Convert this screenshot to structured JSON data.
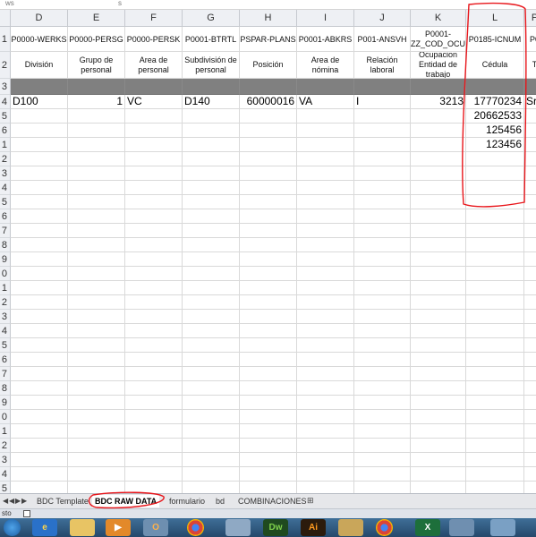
{
  "columns": [
    "D",
    "E",
    "F",
    "G",
    "H",
    "I",
    "J",
    "K",
    "L",
    "P"
  ],
  "rows": [
    "1",
    "2",
    "3",
    "4",
    "5",
    "6",
    "1",
    "2",
    "3",
    "4",
    "5",
    "6",
    "7",
    "8",
    "9",
    "0",
    "1",
    "2",
    "3",
    "4",
    "5",
    "6",
    "7",
    "8",
    "9",
    "0",
    "1",
    "2",
    "3",
    "4",
    "5"
  ],
  "row1_codes": [
    "P0000-WERKS",
    "P0000-PERSG",
    "P0000-PERSK",
    "P0001-BTRTL",
    "PSPAR-PLANS",
    "P0001-ABKRS",
    "P001-ANSVH",
    "P0001-\nZZ_COD_OCU",
    "P0185-ICNUM",
    "P0"
  ],
  "row2_labels": [
    "División",
    "Grupo de personal",
    "Area de personal",
    "Subdivisión de personal",
    "Posición",
    "Area de nómina",
    "Relación laboral",
    "Ocupacion Entidad de trabajo",
    "Cédula",
    "T"
  ],
  "data_row": [
    "D100",
    "1",
    "VC",
    "D140",
    "60000016",
    "VA",
    "I",
    "3213",
    "17770234",
    "Sr."
  ],
  "cedula_extra": [
    "20662533",
    "125456",
    "123456"
  ],
  "sheet_tabs": [
    "BDC Template",
    "BDC RAW DATA",
    "formulario",
    "bd",
    "COMBINACIONES"
  ],
  "active_tab": "BDC RAW DATA",
  "status_text": "sto",
  "top_fragments": [
    "ws",
    "s"
  ],
  "colors": {
    "annotation": "#e8161b",
    "grey_row": "#808080",
    "header_bg": "#eef0f4"
  },
  "taskbar_icons": [
    "windows-start",
    "ie",
    "explorer",
    "media-player",
    "chrome",
    "network",
    "dreamweaver",
    "illustrator",
    "file-manager",
    "paint",
    "chrome",
    "excel"
  ]
}
